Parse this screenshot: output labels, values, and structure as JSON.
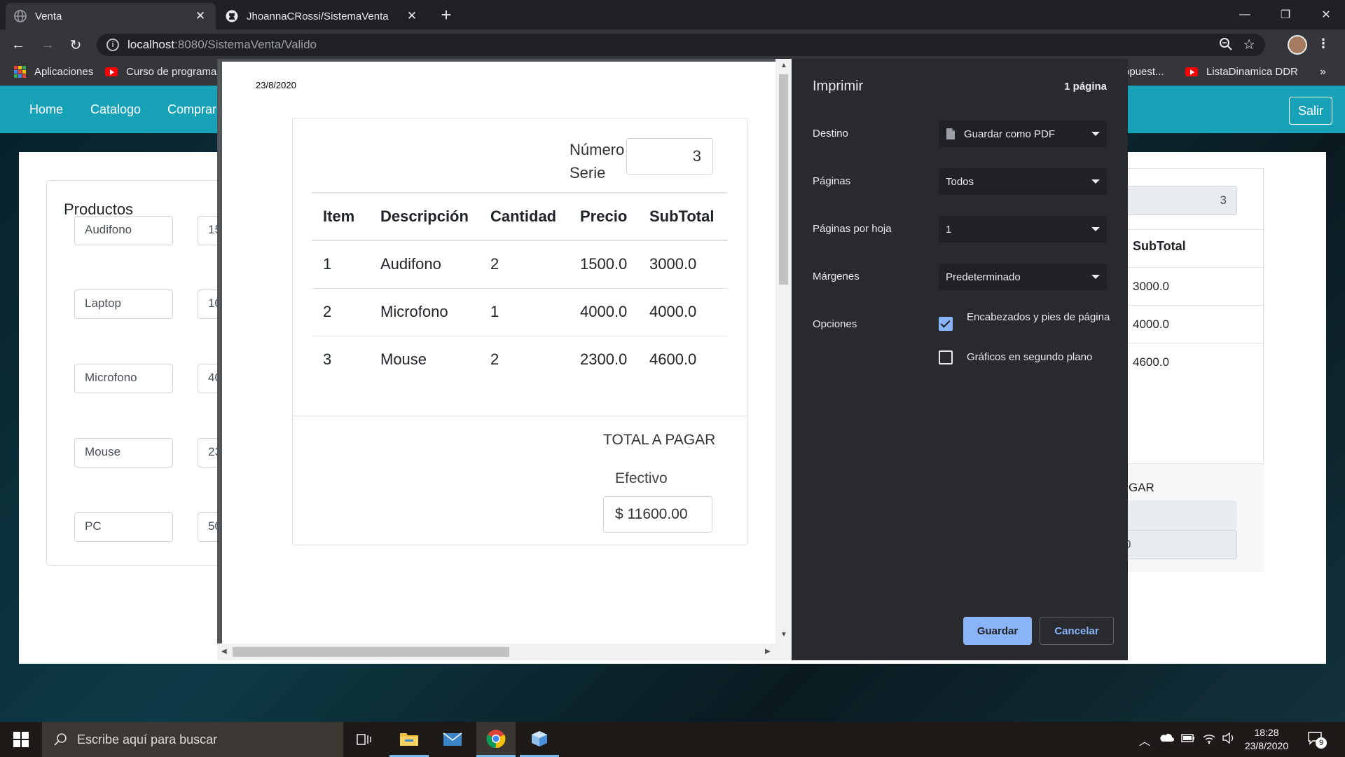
{
  "browser": {
    "tabs": [
      {
        "title": "Venta",
        "active": true
      },
      {
        "title": "JhoannaCRossi/SistemaVenta",
        "active": false
      }
    ],
    "new_tab": "+",
    "url_host": "localhost",
    "url_path": ":8080/SistemaVenta/Valido",
    "bookmarks": [
      {
        "label": "Aplicaciones",
        "icon": "apps-grid-icon"
      },
      {
        "label": "Curso de programa...",
        "icon": "youtube-icon"
      },
      {
        "label": "opuest...",
        "icon": "none"
      },
      {
        "label": "ListaDinamica DDR",
        "icon": "youtube-icon"
      }
    ],
    "bookmarks_overflow": "»"
  },
  "site": {
    "nav": [
      "Home",
      "Catalogo",
      "Comprar"
    ],
    "logout": "Salir",
    "products_title": "Productos",
    "products": [
      {
        "name": "Audifono",
        "price_partial": "15"
      },
      {
        "name": "Laptop",
        "price_partial": "10"
      },
      {
        "name": "Microfono",
        "price_partial": "40"
      },
      {
        "name": "Mouse",
        "price_partial": "23"
      },
      {
        "name": "PC",
        "price_partial": "50"
      }
    ],
    "right_card": {
      "serie": "3",
      "subtotal_header": "SubTotal",
      "subtotals": [
        "3000.0",
        "4000.0",
        "4600.0"
      ],
      "total_label_partial": "GAR",
      "total_partial": "0"
    }
  },
  "preview": {
    "date": "23/8/2020",
    "numero_serie_label_1": "Número",
    "numero_serie_label_2": "Serie",
    "numero_serie": "3",
    "columns": [
      "Item",
      "Descripción",
      "Cantidad",
      "Precio",
      "SubTotal"
    ],
    "rows": [
      [
        "1",
        "Audifono",
        "2",
        "1500.0",
        "3000.0"
      ],
      [
        "2",
        "Microfono",
        "1",
        "4000.0",
        "4000.0"
      ],
      [
        "3",
        "Mouse",
        "2",
        "2300.0",
        "4600.0"
      ]
    ],
    "total_label": "TOTAL A PAGAR",
    "efectivo_label": "Efectivo",
    "total": "$ 11600.00"
  },
  "print": {
    "title": "Imprimir",
    "page_count": "1 página",
    "destino_label": "Destino",
    "destino_value": "Guardar como PDF",
    "paginas_label": "Páginas",
    "paginas_value": "Todos",
    "por_hoja_label": "Páginas por hoja",
    "por_hoja_value": "1",
    "margenes_label": "Márgenes",
    "margenes_value": "Predeterminado",
    "opciones_label": "Opciones",
    "option_headers": "Encabezados y pies de página",
    "option_headers_checked": true,
    "option_background": "Gráficos en segundo plano",
    "option_background_checked": false,
    "save_button": "Guardar",
    "cancel_button": "Cancelar",
    "accent_color": "#8ab4f8"
  },
  "taskbar": {
    "search_placeholder": "Escribe aquí para buscar",
    "time": "18:28",
    "date": "23/8/2020",
    "notifications": "9"
  }
}
